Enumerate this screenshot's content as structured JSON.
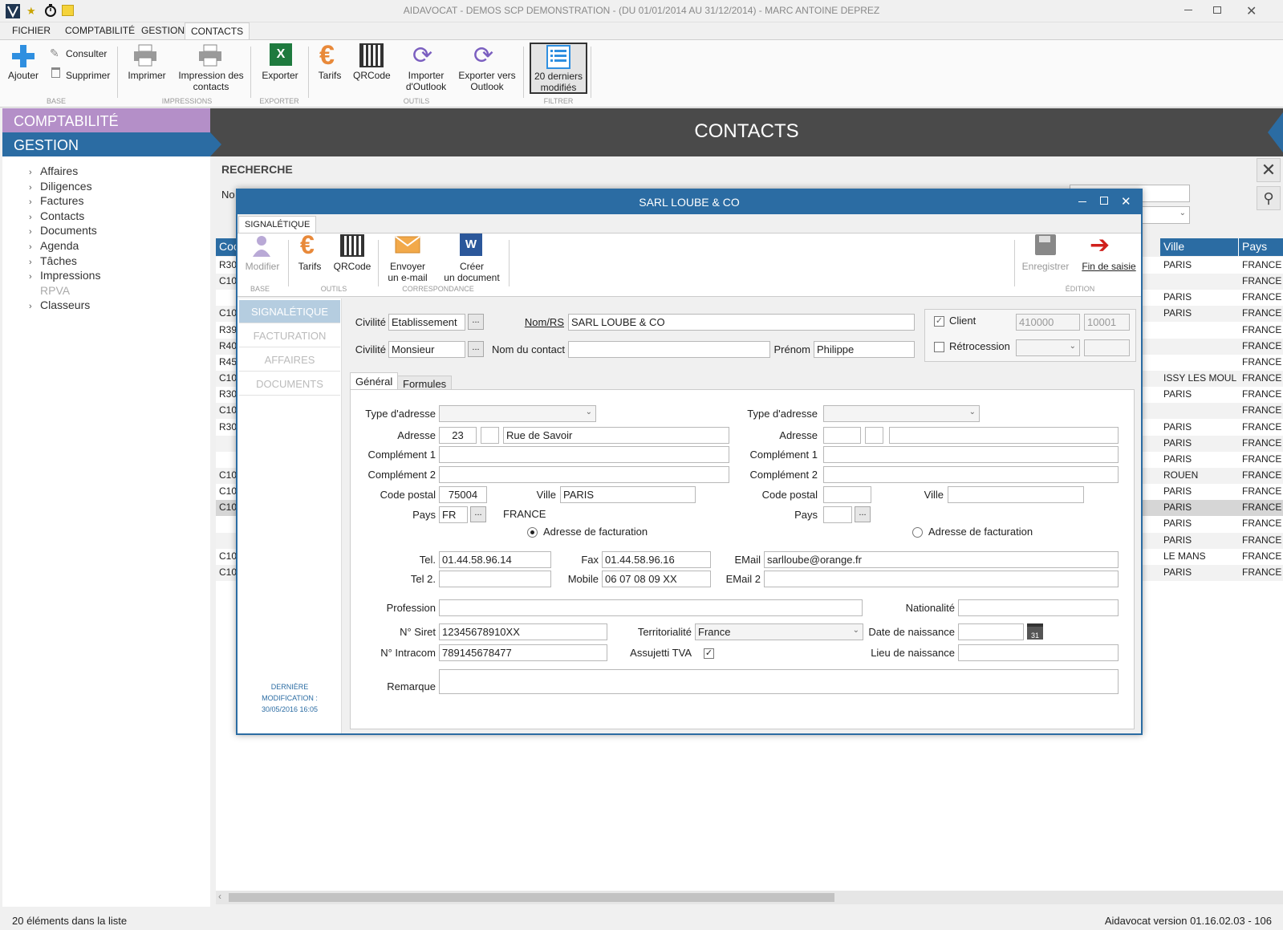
{
  "window": {
    "title": "AIDAVOCAT - DEMOS SCP DEMONSTRATION - (DU 01/01/2014 AU 31/12/2014) - MARC ANTOINE DEPREZ"
  },
  "menu": [
    "FICHIER",
    "COMPTABILITÉ",
    "GESTION",
    "CONTACTS"
  ],
  "ribbon": {
    "ajouter": "Ajouter",
    "consulter": "Consulter",
    "supprimer": "Supprimer",
    "grp_base": "BASE",
    "imprimer": "Imprimer",
    "impression_l1": "Impression des",
    "impression_l2": "contacts",
    "grp_impressions": "IMPRESSIONS",
    "exporter": "Exporter",
    "grp_exporter": "EXPORTER",
    "tarifs": "Tarifs",
    "qrcode": "QRCode",
    "importer_l1": "Importer",
    "importer_l2": "d'Outlook",
    "exporter_outlook_l1": "Exporter vers",
    "exporter_outlook_l2": "Outlook",
    "grp_outils": "OUTILS",
    "derniers_l1": "20 derniers",
    "derniers_l2": "modifiés",
    "grp_filtrer": "FILTRER"
  },
  "sidebar": {
    "comptabilite": "COMPTABILITÉ",
    "gestion": "GESTION",
    "items": [
      "Affaires",
      "Diligences",
      "Factures",
      "Contacts",
      "Documents",
      "Agenda",
      "Tâches",
      "Impressions",
      "RPVA",
      "Classeurs"
    ]
  },
  "main": {
    "title": "CONTACTS",
    "recherche": "RECHERCHE",
    "no_label": "No",
    "col_code": "Coc",
    "col_ville": "Ville",
    "col_pays": "Pays",
    "codes": [
      "R30",
      "C10",
      "",
      "C10",
      "R39",
      "R40",
      "R45",
      "C10",
      "R30",
      "C10",
      "R30",
      "",
      "",
      "C10",
      "C10",
      "C10",
      "",
      "",
      "C10",
      "C10"
    ],
    "villes": [
      "PARIS",
      "",
      "PARIS",
      "PARIS",
      "",
      "",
      "",
      "ISSY LES MOUL",
      "PARIS",
      "",
      "PARIS",
      "PARIS",
      "PARIS",
      "ROUEN",
      "PARIS",
      "PARIS",
      "PARIS",
      "PARIS",
      "LE MANS",
      "PARIS"
    ],
    "pays": [
      "FRANCE",
      "FRANCE",
      "FRANCE",
      "FRANCE",
      "FRANCE",
      "FRANCE",
      "FRANCE",
      "FRANCE",
      "FRANCE",
      "FRANCE",
      "FRANCE",
      "FRANCE",
      "FRANCE",
      "FRANCE",
      "FRANCE",
      "FRANCE",
      "FRANCE",
      "FRANCE",
      "FRANCE",
      "FRANCE"
    ]
  },
  "status": {
    "left": "20 éléments dans la liste",
    "right": "Aidavocat version 01.16.02.03 - 106"
  },
  "dialog": {
    "title": "SARL LOUBE & CO",
    "tab": "SIGNALÉTIQUE",
    "toolbar": {
      "modifier": "Modifier",
      "tarifs": "Tarifs",
      "qrcode": "QRCode",
      "envoyer_l1": "Envoyer",
      "envoyer_l2": "un e-mail",
      "creer_l1": "Créer",
      "creer_l2": "un document",
      "enregistrer": "Enregistrer",
      "fin": "Fin de saisie",
      "grp_base": "BASE",
      "grp_outils": "OUTILS",
      "grp_corresp": "CORRESPONDANCE",
      "grp_edition": "ÉDITION"
    },
    "nav": [
      "SIGNALÉTIQUE",
      "FACTURATION",
      "AFFAIRES",
      "DOCUMENTS"
    ],
    "last_mod_l1": "DERNIÈRE",
    "last_mod_l2": "MODIFICATION :",
    "last_mod_l3": "30/05/2016 16:05",
    "labels": {
      "civilite": "Civilité",
      "nomrs": "Nom/RS",
      "nom_contact": "Nom du contact",
      "prenom": "Prénom",
      "client": "Client",
      "retro": "Rétrocession",
      "type_adresse": "Type d'adresse",
      "adresse": "Adresse",
      "comp1": "Complément 1",
      "comp2": "Complément 2",
      "code_postal": "Code postal",
      "ville": "Ville",
      "pays": "Pays",
      "adr_fact": "Adresse de facturation",
      "tel": "Tel.",
      "fax": "Fax",
      "email": "EMail",
      "tel2": "Tel 2.",
      "mobile": "Mobile",
      "email2": "EMail 2",
      "profession": "Profession",
      "nationalite": "Nationalité",
      "siret": "N° Siret",
      "territorialite": "Territorialité",
      "date_naissance": "Date de naissance",
      "intracom": "N° Intracom",
      "assujetti": "Assujetti TVA",
      "lieu_naissance": "Lieu de naissance",
      "remarque": "Remarque"
    },
    "tabs": [
      "Général",
      "Formules"
    ],
    "values": {
      "civilite1": "Etablissement",
      "nomrs": "SARL LOUBE & CO",
      "civilite2": "Monsieur",
      "nom_contact": "",
      "prenom": "Philippe",
      "client_code": "410000",
      "client_num": "10001",
      "adr_num": "23",
      "adr_rue": "Rue de Savoir",
      "code_postal": "75004",
      "ville": "PARIS",
      "pays_code": "FR",
      "pays_name": "FRANCE",
      "tel": "01.44.58.96.14",
      "fax": "01.44.58.96.16",
      "email": "sarlloube@orange.fr",
      "tel2": "",
      "mobile": "06 07 08 09 XX",
      "email2": "",
      "siret": "12345678910XX",
      "territorialite": "France",
      "intracom": "789145678477",
      "date_cal": "31"
    }
  }
}
